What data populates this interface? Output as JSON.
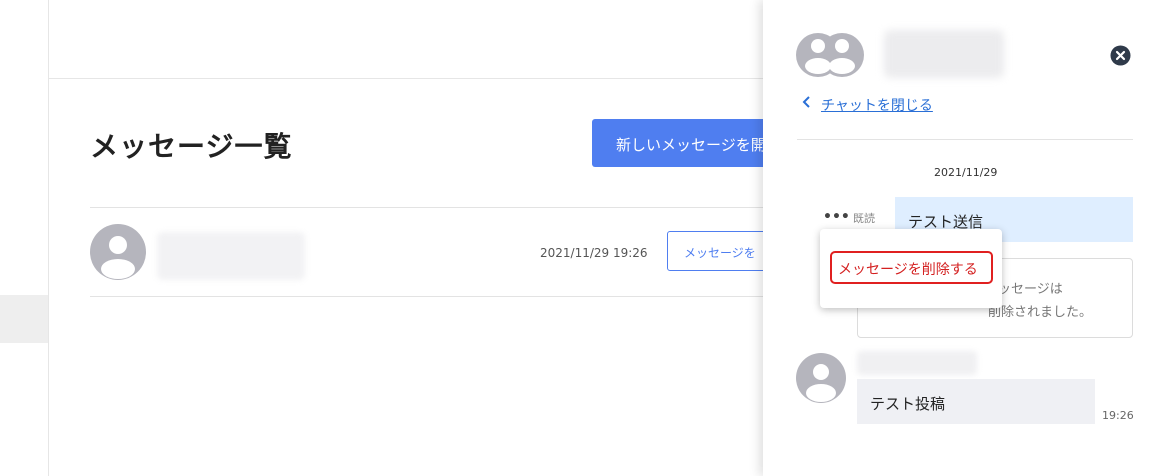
{
  "main": {
    "title": "メッセージ一覧",
    "new_message_button": "新しいメッセージを開",
    "rows": [
      {
        "time": "2021/11/29 19:26",
        "button": "メッセージを"
      }
    ]
  },
  "panel": {
    "back_link": "チャットを閉じる",
    "date": "2021/11/29",
    "my_message": {
      "read_label": "既読",
      "text": "テスト送信"
    },
    "deleted_message": {
      "line1": "ッセージは",
      "line2": "削除されました。"
    },
    "popup_menu": {
      "delete_label": "メッセージを削除する"
    },
    "other_message": {
      "text": "テスト投稿",
      "time": "19:26"
    }
  },
  "colors": {
    "primary": "#4f7ef0",
    "danger": "#d42020",
    "link": "#2a6fd6",
    "my_bubble": "#dfeeff",
    "other_bubble": "#eff0f4"
  }
}
